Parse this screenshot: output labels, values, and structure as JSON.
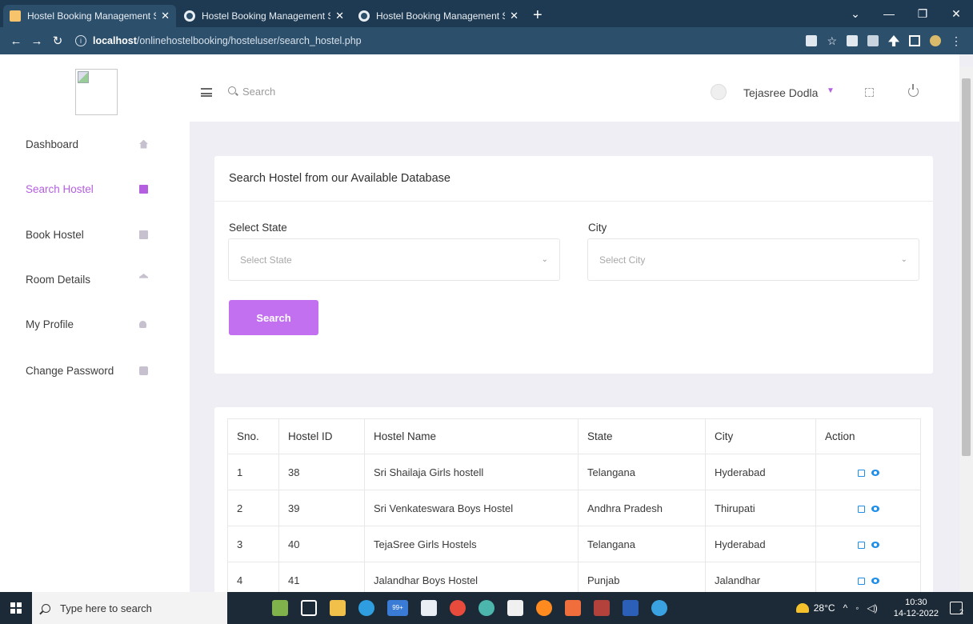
{
  "browser": {
    "tabs": [
      {
        "title": "Hostel Booking Management Sys"
      },
      {
        "title": "Hostel Booking Management Sys"
      },
      {
        "title": "Hostel Booking Management Sys"
      }
    ],
    "url_host": "localhost",
    "url_path": "/onlinehostelbooking/hosteluser/search_hostel.php"
  },
  "sidebar": {
    "items": [
      {
        "label": "Dashboard",
        "icon": "home-icon"
      },
      {
        "label": "Search Hostel",
        "icon": "book-icon",
        "active": true
      },
      {
        "label": "Book Hostel",
        "icon": "book-icon"
      },
      {
        "label": "Room Details",
        "icon": "bank-icon"
      },
      {
        "label": "My Profile",
        "icon": "user-icon"
      },
      {
        "label": "Change Password",
        "icon": "lock-icon"
      }
    ]
  },
  "header": {
    "search_placeholder": "Search",
    "user_name": "Tejasree Dodla"
  },
  "search_card": {
    "title": "Search Hostel from our Available Database",
    "state_label": "Select State",
    "state_placeholder": "Select State",
    "city_label": "City",
    "city_placeholder": "Select City",
    "button_label": "Search"
  },
  "table": {
    "headers": [
      "Sno.",
      "Hostel ID",
      "Hostel Name",
      "State",
      "City",
      "Action"
    ],
    "rows": [
      [
        "1",
        "38",
        "Sri Shailaja Girls hostell",
        "Telangana",
        "Hyderabad"
      ],
      [
        "2",
        "39",
        "Sri Venkateswara Boys Hostel",
        "Andhra Pradesh",
        "Thirupati"
      ],
      [
        "3",
        "40",
        "TejaSree Girls Hostels",
        "Telangana",
        "Hyderabad"
      ],
      [
        "4",
        "41",
        "Jalandhar Boys Hostel",
        "Punjab",
        "Jalandhar"
      ]
    ]
  },
  "taskbar": {
    "search_text": "Type here to search",
    "temperature": "28°C",
    "time": "10:30",
    "date": "14-12-2022",
    "notification_count": "2",
    "badge_count": "99+"
  },
  "colors": {
    "accent": "#c26ff0",
    "active_text": "#b45fe0",
    "action_icon": "#1f8ee8",
    "browser_bar": "#2c4f6c"
  }
}
